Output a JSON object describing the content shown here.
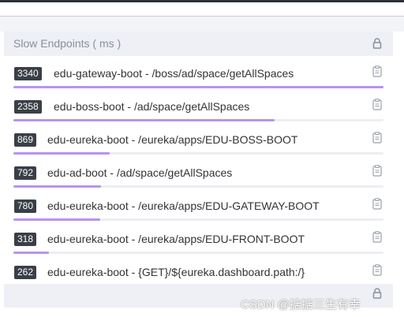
{
  "panel": {
    "title": "Slow Endpoints ( ms )",
    "header_icon": "lock-icon"
  },
  "endpoints": [
    {
      "ms": "3340",
      "name": "edu-gateway-boot - /boss/ad/space/getAllSpaces",
      "fraction": 1.0
    },
    {
      "ms": "2358",
      "name": "edu-boss-boot - /ad/space/getAllSpaces",
      "fraction": 0.706
    },
    {
      "ms": "869",
      "name": "edu-eureka-boot - /eureka/apps/EDU-BOSS-BOOT",
      "fraction": 0.26
    },
    {
      "ms": "792",
      "name": "edu-ad-boot - /ad/space/getAllSpaces",
      "fraction": 0.237
    },
    {
      "ms": "780",
      "name": "edu-eureka-boot - /eureka/apps/EDU-GATEWAY-BOOT",
      "fraction": 0.234
    },
    {
      "ms": "318",
      "name": "edu-eureka-boot - /eureka/apps/EDU-FRONT-BOOT",
      "fraction": 0.095
    },
    {
      "ms": "262",
      "name": "edu-eureka-boot - {GET}/${eureka.dashboard.path:/}",
      "fraction": 0.078
    }
  ],
  "row_icon": "clipboard-icon",
  "colors": {
    "bar_fill": "#b993ee",
    "badge_bg": "#3a3f47"
  },
  "watermark": "CSDN @掂掂三生有幸"
}
